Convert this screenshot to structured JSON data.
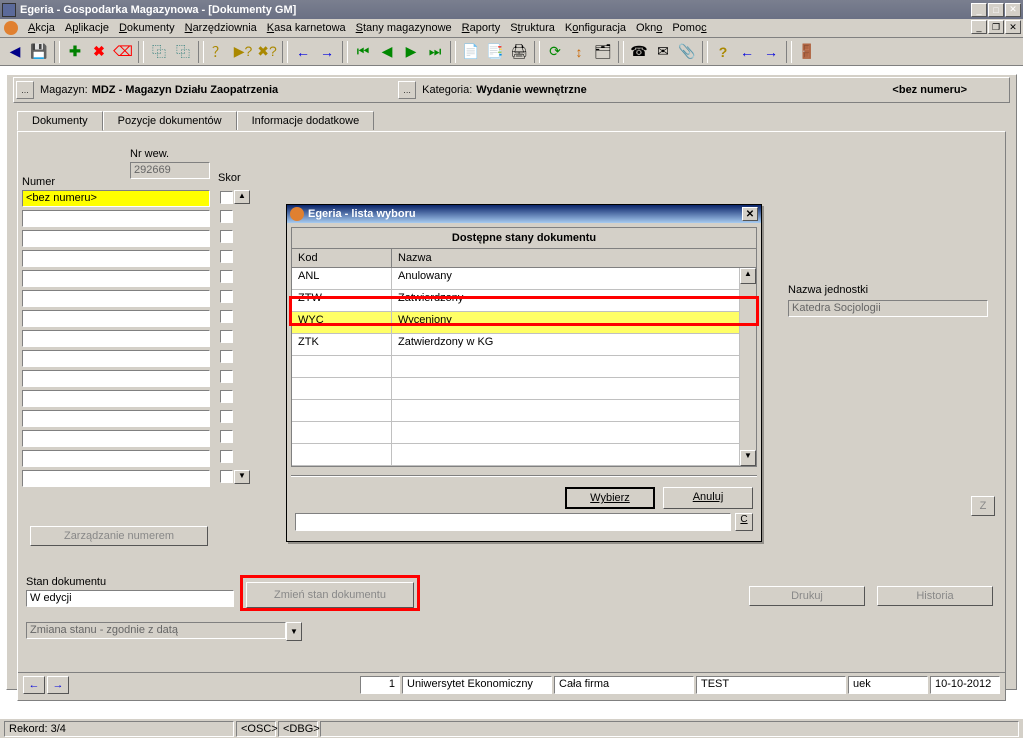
{
  "window": {
    "title": "Egeria - Gospodarka Magazynowa - [Dokumenty GM]"
  },
  "menus": [
    "Akcja",
    "Aplikacje",
    "Dokumenty",
    "Narzędziownia",
    "Kasa karnetowa",
    "Stany magazynowe",
    "Raporty",
    "Struktura",
    "Konfiguracja",
    "Okno",
    "Pomoc"
  ],
  "header": {
    "mag_label": "Magazyn:",
    "mag_value": "MDZ - Magazyn Działu Zaopatrzenia",
    "cat_label": "Kategoria:",
    "cat_value": "Wydanie wewnętrzne",
    "right": "<bez numeru>"
  },
  "tabs": {
    "t0": "Dokumenty",
    "t1": "Pozycje dokumentów",
    "t2": "Informacje dodatkowe"
  },
  "panel": {
    "numer_label": "Numer",
    "nrwew_label": "Nr wew.",
    "nrwew_value": "292669",
    "skor_label": "Skor",
    "row0": "<bez numeru>",
    "zarz_btn": "Zarządzanie numerem",
    "stan_label": "Stan dokumentu",
    "stan_value": "W edycji",
    "zmien_btn": "Zmień stan dokumentu",
    "combo": "Zmiana stanu - zgodnie z datą",
    "nazwa_label": "Nazwa jednostki",
    "nazwa_value": "Katedra Socjologii",
    "z_btn": "Z",
    "drukuj": "Drukuj",
    "historia": "Historia"
  },
  "modal": {
    "title": "Egeria - lista wyboru",
    "head": "Dostępne stany dokumentu",
    "col0": "Kod",
    "col1": "Nazwa",
    "rows": [
      {
        "kod": "ANL",
        "nazwa": "Anulowany"
      },
      {
        "kod": "ZTW",
        "nazwa": "Zatwierdzony"
      },
      {
        "kod": "WYC",
        "nazwa": "Wyceniony"
      },
      {
        "kod": "ZTK",
        "nazwa": "Zatwierdzony w KG"
      }
    ],
    "wybierz": "Wybierz",
    "anuluj": "Anuluj",
    "c": "C"
  },
  "bottom": {
    "v1": "1",
    "v2": "Uniwersytet Ekonomiczny",
    "v3": "Cała firma",
    "v4": "TEST",
    "v5": "uek",
    "v6": "10-10-2012"
  },
  "status": {
    "rekord": "Rekord: 3/4",
    "osc": "<OSC>",
    "dbg": "<DBG>"
  }
}
